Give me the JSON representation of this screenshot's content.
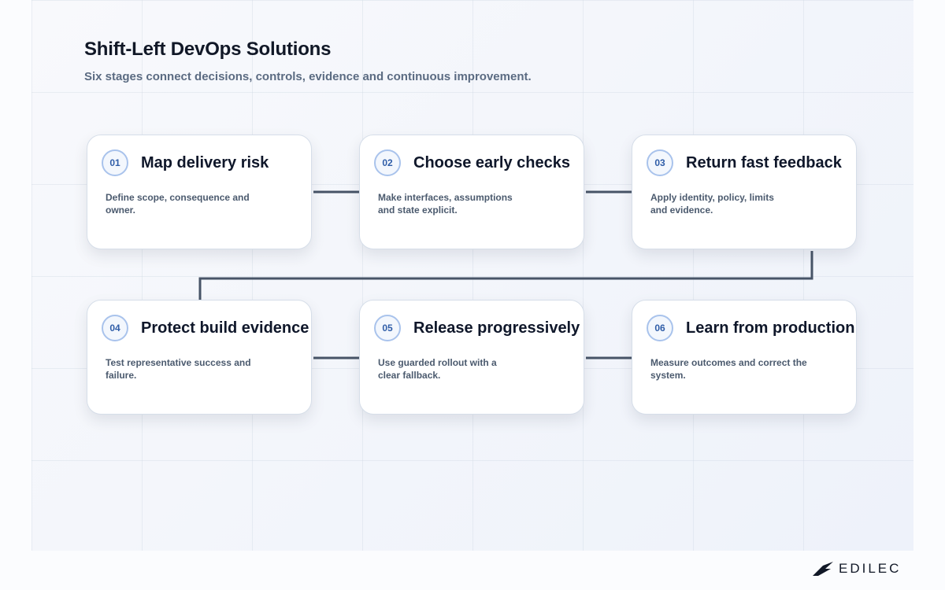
{
  "header": {
    "title": "Shift-Left DevOps Solutions",
    "subtitle": "Six stages connect decisions, controls, evidence and continuous improvement."
  },
  "stages": [
    {
      "number": "01",
      "title": "Map delivery risk",
      "description": "Define scope, consequence and owner."
    },
    {
      "number": "02",
      "title": "Choose early checks",
      "description": "Make interfaces, assumptions and state explicit."
    },
    {
      "number": "03",
      "title": "Return fast feedback",
      "description": "Apply identity, policy, limits and evidence."
    },
    {
      "number": "04",
      "title": "Protect build evidence",
      "description": "Test representative success and failure."
    },
    {
      "number": "05",
      "title": "Release progressively",
      "description": "Use guarded rollout with a clear fallback."
    },
    {
      "number": "06",
      "title": "Learn from production",
      "description": "Measure outcomes and correct the system."
    }
  ],
  "brand": {
    "name": "EDILEC"
  },
  "colors": {
    "connector": "#475467",
    "badge_border": "#a9c3ec",
    "badge_text": "#2f5da8"
  }
}
